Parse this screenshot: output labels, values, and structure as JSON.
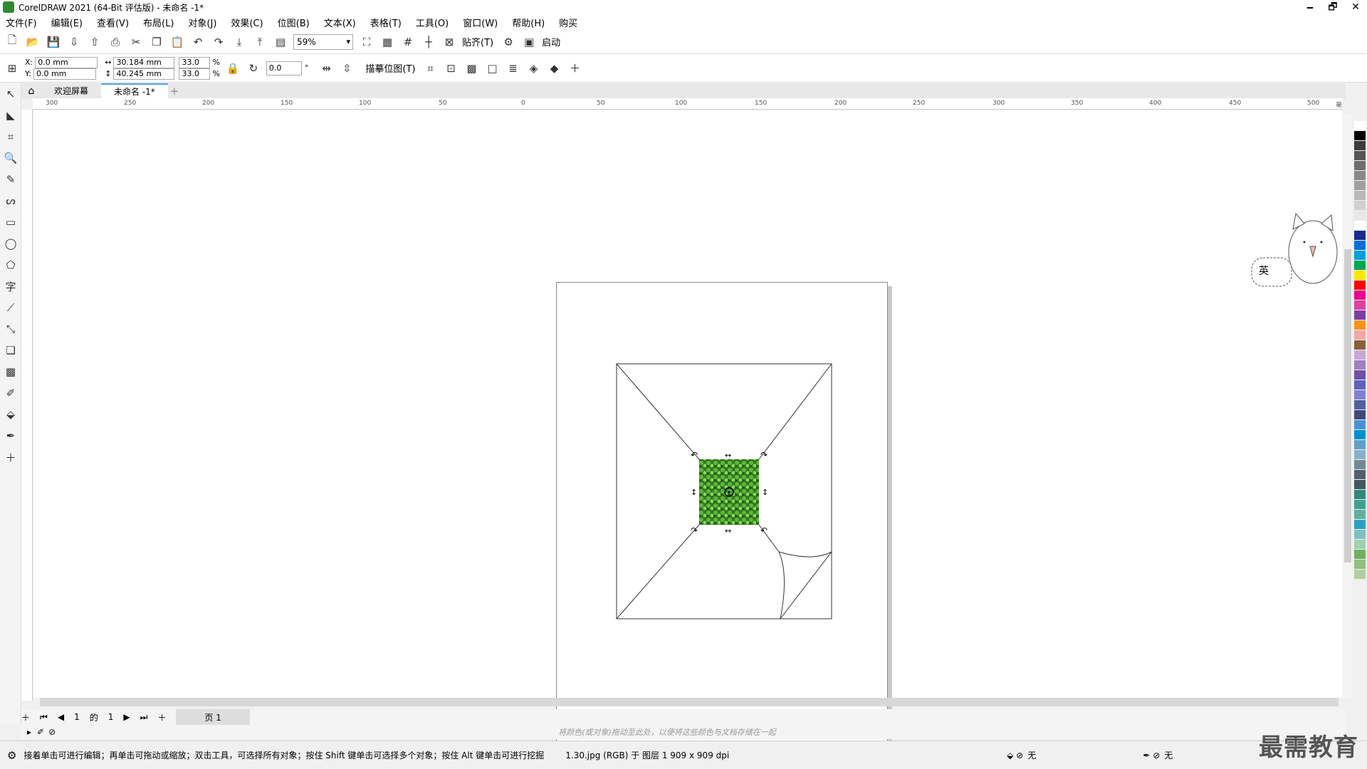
{
  "window": {
    "title": "CorelDRAW 2021 (64-Bit 评估版) - 未命名 -1*",
    "controls": [
      "🗕",
      "🗗",
      "✕"
    ]
  },
  "menu": [
    "文件(F)",
    "编辑(E)",
    "查看(V)",
    "布局(L)",
    "对象(J)",
    "效果(C)",
    "位图(B)",
    "文本(X)",
    "表格(T)",
    "工具(O)",
    "窗口(W)",
    "帮助(H)",
    "购买"
  ],
  "toolbar": {
    "zoom": "59%",
    "snap_label": "贴齐(T)",
    "start_label": "启动"
  },
  "properties": {
    "x_label": "X:",
    "x_value": "0.0 mm",
    "y_label": "Y:",
    "y_value": "0.0 mm",
    "width": "30.184 mm",
    "height": "40.245 mm",
    "scale_w": "33.0",
    "scale_h": "33.0",
    "percent": "%",
    "rotation": "0.0",
    "degree": "°",
    "trace_label": "描摹位图(T)"
  },
  "tabs": {
    "welcome": "欢迎屏幕",
    "document": "未命名 -1*",
    "add": "+"
  },
  "ruler": {
    "h_labels": [
      "300",
      "250",
      "200",
      "150",
      "100",
      "50",
      "0",
      "50",
      "100",
      "150",
      "200",
      "250",
      "300",
      "350",
      "400",
      "450",
      "500"
    ],
    "unit": "毫米"
  },
  "pagenav": {
    "current": "1",
    "of": "的",
    "total": "1",
    "page_tab": "页 1"
  },
  "colorbar": {
    "hint": "将颜色(或对象)拖动至此处，以便将这些颜色与文档存储在一起"
  },
  "status": {
    "message": "接着单击可进行编辑；再单击可拖动或缩放；双击工具，可选择所有对象；按住 Shift 键单击可选择多个对象；按住 Alt 键单击可进行挖掘",
    "object_info": "1.30.jpg (RGB) 于 图层 1 909 x 909 dpi",
    "fill_label": "无",
    "outline_label": "无"
  },
  "ime": {
    "label": "英"
  },
  "watermark": "最需教育",
  "palette": [
    "#ffffff",
    "#000000",
    "#3a3a3a",
    "#555555",
    "#6e6e6e",
    "#888888",
    "#a0a0a0",
    "#b8b8b8",
    "#d0d0d0",
    "#e8e8e8",
    "#ffffff",
    "#1a2a8c",
    "#0a6fd6",
    "#00a0e0",
    "#00a651",
    "#ffe800",
    "#ff0000",
    "#ec008c",
    "#e040a0",
    "#7a3fa0",
    "#f7941d",
    "#f4a6a6",
    "#8b5e3c",
    "#c8a8d8",
    "#a080c0",
    "#7050a8",
    "#6060c0",
    "#8080d0",
    "#5060a0",
    "#404878",
    "#4a90d9",
    "#0090d0",
    "#60a0c8",
    "#88b0c8",
    "#708898",
    "#506070",
    "#405860",
    "#308878",
    "#40a090",
    "#60b0a0",
    "#30a0c0",
    "#80c0c0",
    "#a0d0b0",
    "#70b060",
    "#90c080",
    "#b0d0a0"
  ]
}
